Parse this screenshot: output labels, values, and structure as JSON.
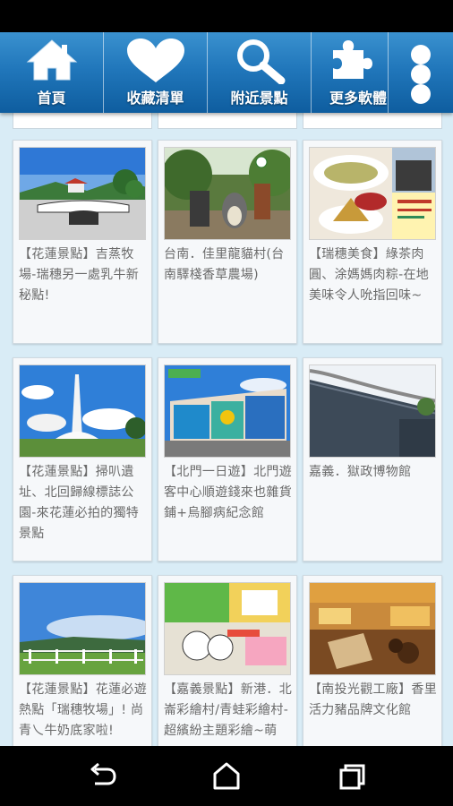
{
  "tabs": [
    {
      "label": "首頁",
      "icon": "home-icon"
    },
    {
      "label": "收藏清單",
      "icon": "heart-icon"
    },
    {
      "label": "附近景點",
      "icon": "magnifier-icon"
    },
    {
      "label": "更多軟體",
      "icon": "puzzle-icon"
    }
  ],
  "overflow_icon": "more-vert-icon",
  "cards": [
    {
      "title": "【花蓮景點】吉蒸牧場-瑞穗另一處乳牛新秘點!",
      "image": "farm-photo"
    },
    {
      "title": "台南．佳里龍貓村(台南驛棧香草農場)",
      "image": "totoro-garden-photo"
    },
    {
      "title": "【瑞穗美食】綠茶肉圓、涂媽媽肉粽-在地美味令人吮指回味~",
      "image": "food-photo"
    },
    {
      "title": "【花蓮景點】掃叭遺址、北回歸線標誌公園-來花蓮必拍的獨特景點",
      "image": "monument-photo"
    },
    {
      "title": "【北門一日遊】北門遊客中心順遊錢來也雜貨鋪+烏腳病紀念館",
      "image": "mural-house-photo"
    },
    {
      "title": "嘉義．獄政博物館",
      "image": "prison-wall-photo"
    },
    {
      "title": "【花蓮景點】花蓮必遊熱點「瑞穗牧場」! 尚青乀牛奶底家啦!",
      "image": "pasture-photo"
    },
    {
      "title": "【嘉義景點】新港．北崙彩繪村/青蛙彩繪村-超繽紛主題彩繪~萌",
      "image": "painted-village-photo"
    },
    {
      "title": "【南投光觀工廠】香里活力豬品牌文化館",
      "image": "factory-photo"
    }
  ],
  "nav": {
    "back": "back-icon",
    "home": "home-nav-icon",
    "recents": "recents-icon"
  },
  "colors": {
    "tabbar": "#2177bb",
    "background": "#d9ecf6",
    "card_text": "#6a6a6a"
  }
}
